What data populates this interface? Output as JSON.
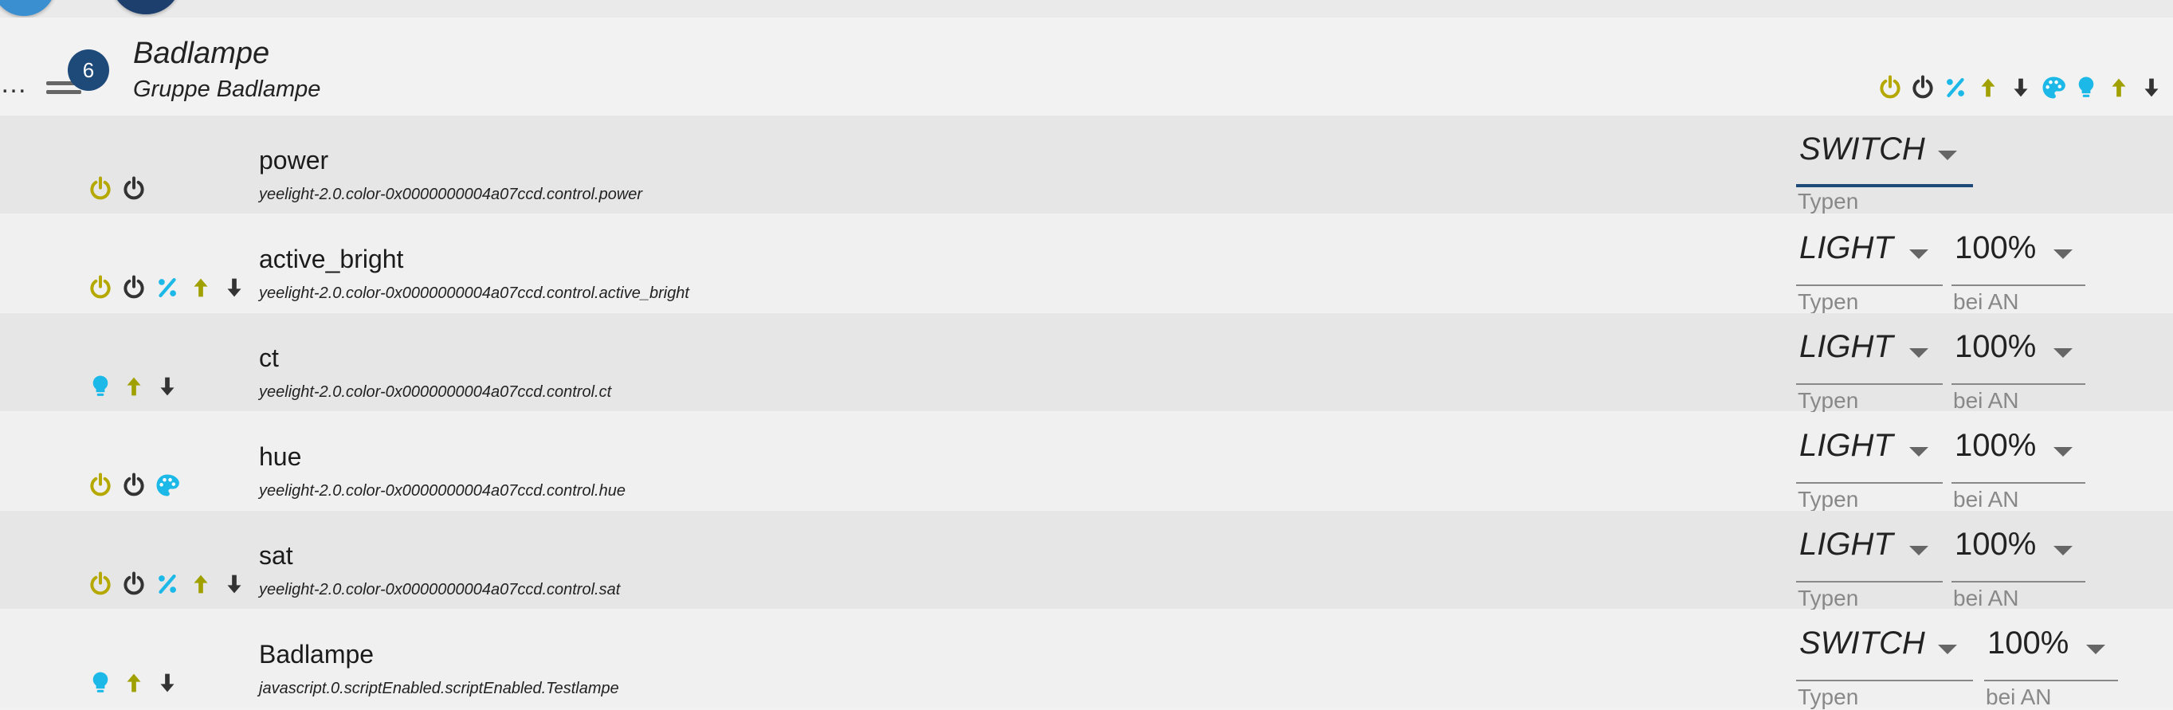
{
  "header": {
    "badge_count": "6",
    "edge_char": "…",
    "title": "Badlampe",
    "subtitle": "Gruppe Badlampe",
    "icons": [
      "power-on-icon",
      "power-off-icon",
      "percent-icon",
      "arrow-up-icon",
      "arrow-down-icon",
      "palette-icon",
      "lightbulb-icon",
      "arrow-up-icon",
      "arrow-down-icon"
    ]
  },
  "colors": {
    "accent": "#1e4a7a",
    "power_on": "#b5a800",
    "cyan": "#1bb8e8",
    "olive": "#a0a000",
    "dark_icon": "#333333",
    "row_dark": "#e6e6e6",
    "row_light": "#f0f0f0"
  },
  "rows": [
    {
      "name": "power",
      "id": "yeelight-2.0.color-0x0000000004a07ccd.control.power",
      "icons": [
        "power-on-icon",
        "power-off-icon"
      ],
      "type": "SWITCH",
      "type_label": "Typen",
      "active": true
    },
    {
      "name": "active_bright",
      "id": "yeelight-2.0.color-0x0000000004a07ccd.control.active_bright",
      "icons": [
        "power-on-icon",
        "power-off-icon",
        "percent-icon",
        "arrow-up-icon",
        "arrow-down-icon"
      ],
      "type": "LIGHT",
      "type_label": "Typen",
      "level": "100%",
      "level_label": "bei AN"
    },
    {
      "name": "ct",
      "id": "yeelight-2.0.color-0x0000000004a07ccd.control.ct",
      "icons": [
        "lightbulb-icon",
        "arrow-up-icon",
        "arrow-down-icon"
      ],
      "type": "LIGHT",
      "type_label": "Typen",
      "level": "100%",
      "level_label": "bei AN"
    },
    {
      "name": "hue",
      "id": "yeelight-2.0.color-0x0000000004a07ccd.control.hue",
      "icons": [
        "power-on-icon",
        "power-off-icon",
        "palette-icon"
      ],
      "type": "LIGHT",
      "type_label": "Typen",
      "level": "100%",
      "level_label": "bei AN"
    },
    {
      "name": "sat",
      "id": "yeelight-2.0.color-0x0000000004a07ccd.control.sat",
      "icons": [
        "power-on-icon",
        "power-off-icon",
        "percent-icon",
        "arrow-up-icon",
        "arrow-down-icon"
      ],
      "type": "LIGHT",
      "type_label": "Typen",
      "level": "100%",
      "level_label": "bei AN"
    },
    {
      "name": "Badlampe",
      "id": "javascript.0.scriptEnabled.scriptEnabled.Testlampe",
      "icons": [
        "lightbulb-icon",
        "arrow-up-icon",
        "arrow-down-icon"
      ],
      "type": "SWITCH",
      "type_label": "Typen",
      "level": "100%",
      "level_label": "bei AN"
    }
  ]
}
